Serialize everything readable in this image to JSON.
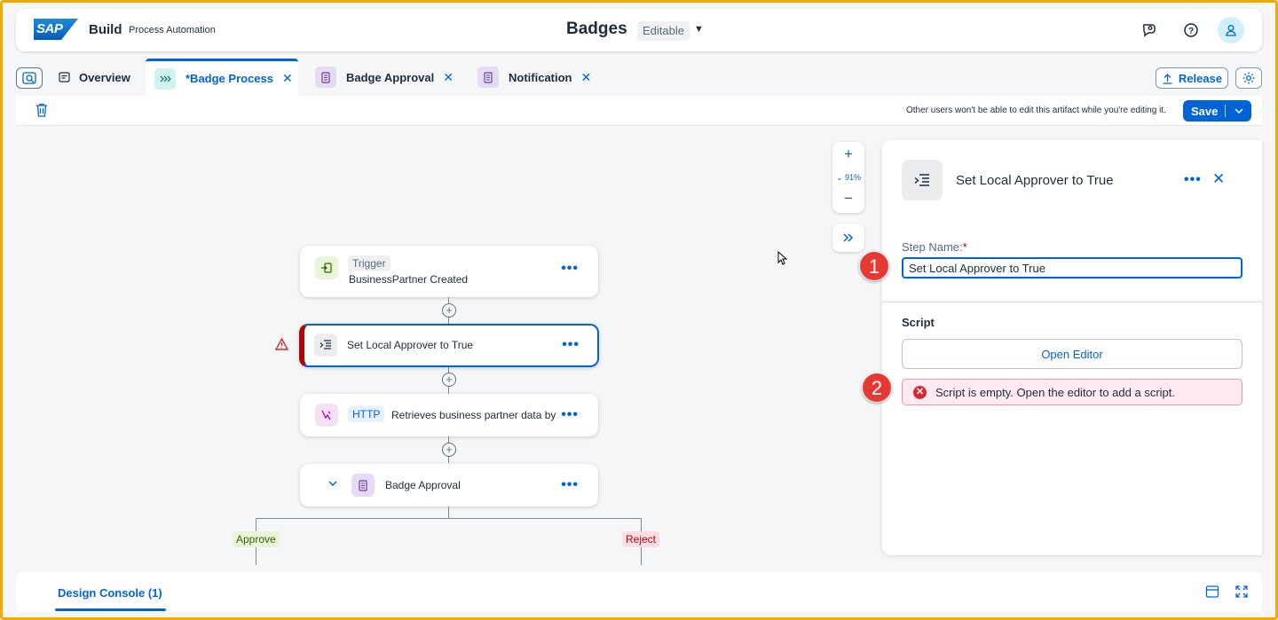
{
  "shell": {
    "brand_logo": "SAP",
    "brand_name": "Build",
    "brand_sub": "Process Automation",
    "project_title": "Badges",
    "mode_label": "Editable"
  },
  "tabs": [
    {
      "label": "Overview",
      "icon": "overview-icon",
      "active": false
    },
    {
      "label": "*Badge Process",
      "icon": "process-icon",
      "active": true
    },
    {
      "label": "Badge Approval",
      "icon": "form-icon",
      "active": false
    },
    {
      "label": "Notification",
      "icon": "form-icon",
      "active": false
    }
  ],
  "actions": {
    "release_label": "Release",
    "save_label": "Save"
  },
  "toolbar": {
    "lock_message": "Other users won't be able to edit this artifact while you're editing it."
  },
  "zoom": {
    "level": "91%"
  },
  "nodes": {
    "trigger": {
      "tag": "Trigger",
      "label": "BusinessPartner Created"
    },
    "script": {
      "label": "Set Local Approver to True"
    },
    "http": {
      "tag": "HTTP",
      "label": "Retrieves business partner data by"
    },
    "approval": {
      "label": "Badge Approval"
    }
  },
  "branches": {
    "approve": "Approve",
    "reject": "Reject"
  },
  "panel": {
    "title": "Set Local Approver to True",
    "step_name_label": "Step Name:",
    "required_mark": "*",
    "step_name_value": "Set Local Approver to True",
    "script_heading": "Script",
    "open_editor_label": "Open Editor",
    "error_message": "Script is empty. Open the editor to add a script."
  },
  "callouts": {
    "one": "1",
    "two": "2"
  },
  "console": {
    "tab_label": "Design Console (1)"
  },
  "colors": {
    "accent": "#0064d9",
    "error": "#d9282f",
    "callout": "#e43a33",
    "frame": "#f0ab00"
  }
}
